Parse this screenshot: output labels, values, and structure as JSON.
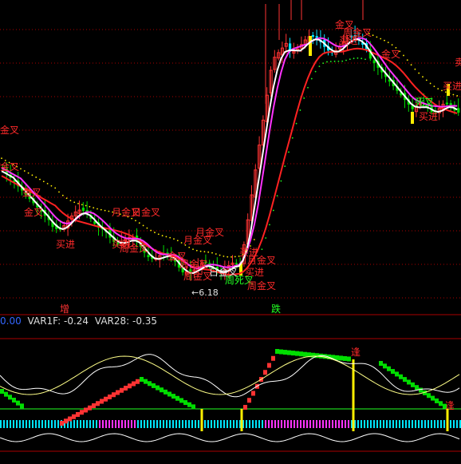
{
  "colors": {
    "up": "#ff3333",
    "down": "#00dd00",
    "cyan": "#00e5ff",
    "yellow": "#ffee00",
    "white": "#ffffff",
    "magenta": "#ff33ff",
    "red_line": "#ff2222",
    "green_dot": "#22ff22",
    "grid": "#aa0000",
    "label_red": "#ff2a2a",
    "label_green": "#22ff22",
    "label_white": "#e0e0e0",
    "label_blue": "#3366ff"
  },
  "axis_labels": {
    "zeng": "增",
    "die": "跌"
  },
  "indicator": {
    "prefix": "0.00",
    "var1f": "VAR1F: -0.24",
    "var28": "VAR28: -0.35"
  },
  "low_marker": "6.18",
  "annotations": [
    {
      "text": "金叉",
      "color": "red"
    },
    {
      "text": "金叉",
      "color": "red"
    },
    {
      "text": "金叉",
      "color": "red"
    },
    {
      "text": "金叉",
      "color": "red"
    },
    {
      "text": "买进",
      "color": "red"
    },
    {
      "text": "月金叉",
      "color": "red"
    },
    {
      "text": "周金叉",
      "color": "red"
    },
    {
      "text": "日金叉",
      "color": "red"
    },
    {
      "text": "月金叉",
      "color": "red"
    },
    {
      "text": "金叉",
      "color": "red"
    },
    {
      "text": "买进",
      "color": "red"
    },
    {
      "text": "周金叉",
      "color": "red"
    },
    {
      "text": "周金叉",
      "color": "red"
    },
    {
      "text": "月金叉",
      "color": "red"
    },
    {
      "text": "买进",
      "color": "red"
    },
    {
      "text": "日金叉",
      "color": "white"
    },
    {
      "text": "周死叉",
      "color": "green"
    },
    {
      "text": "买进",
      "color": "red"
    },
    {
      "text": "月金叉",
      "color": "red"
    },
    {
      "text": "周金叉",
      "color": "red"
    },
    {
      "text": "买进",
      "color": "red"
    },
    {
      "text": "死叉",
      "color": "green"
    },
    {
      "text": "金叉",
      "color": "red"
    },
    {
      "text": "周金叉",
      "color": "red"
    },
    {
      "text": "买进",
      "color": "red"
    },
    {
      "text": "金叉",
      "color": "red"
    },
    {
      "text": "买进",
      "color": "red"
    },
    {
      "text": "卖",
      "color": "red"
    },
    {
      "text": "逢",
      "color": "red"
    },
    {
      "text": "逢",
      "color": "red"
    }
  ],
  "chart_data": [
    {
      "type": "candlestick",
      "title": "",
      "xlabel": "",
      "ylabel": "",
      "bars": 120,
      "price_low_marked": 6.18,
      "lines": [
        "white fast average",
        "magenta average",
        "red slow average",
        "green dotted trailing line"
      ]
    },
    {
      "type": "bar",
      "title": "",
      "series": [
        {
          "name": "VAR1F",
          "last_value": -0.24
        },
        {
          "name": "VAR28",
          "last_value": -0.35
        }
      ]
    }
  ]
}
